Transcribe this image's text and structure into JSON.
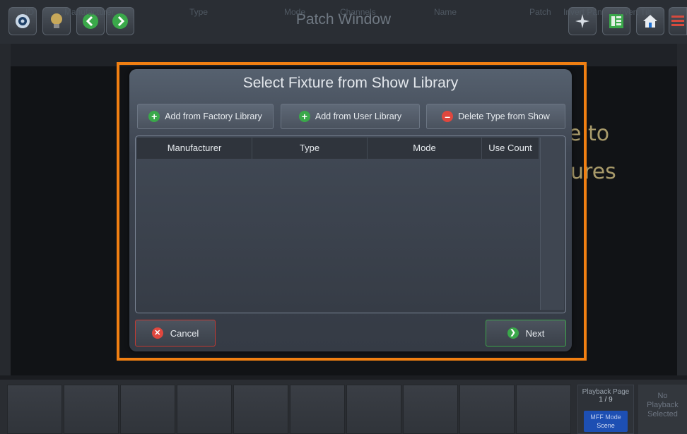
{
  "window": {
    "title": "Patch Window"
  },
  "patch_columns": [
    "ID",
    "Manufacturer",
    "Type",
    "Mode",
    "Channels",
    "Name",
    "Patch",
    "Invert Pan",
    "Invert Tilt"
  ],
  "background_fragments": [
    "e to",
    "ures"
  ],
  "dialog": {
    "title": "Select Fixture from Show Library",
    "add_factory_label": "Add from Factory Library",
    "add_user_label": "Add from User Library",
    "delete_type_label": "Delete Type from Show",
    "table_columns": [
      "Manufacturer",
      "Type",
      "Mode",
      "Use Count"
    ],
    "cancel_label": "Cancel",
    "next_label": "Next"
  },
  "playback": {
    "page_label": "Playback Page",
    "page_value": "1 / 9",
    "mff_mode_label": "MFF Mode",
    "mff_mode_value": "Scene",
    "no_playback_line1": "No",
    "no_playback_line2": "Playback",
    "no_playback_line3": "Selected"
  },
  "colors": {
    "highlight": "#f07f12",
    "accent_green": "#3aa84a",
    "accent_red": "#e0473e",
    "mff_blue": "#1d4fb3"
  }
}
